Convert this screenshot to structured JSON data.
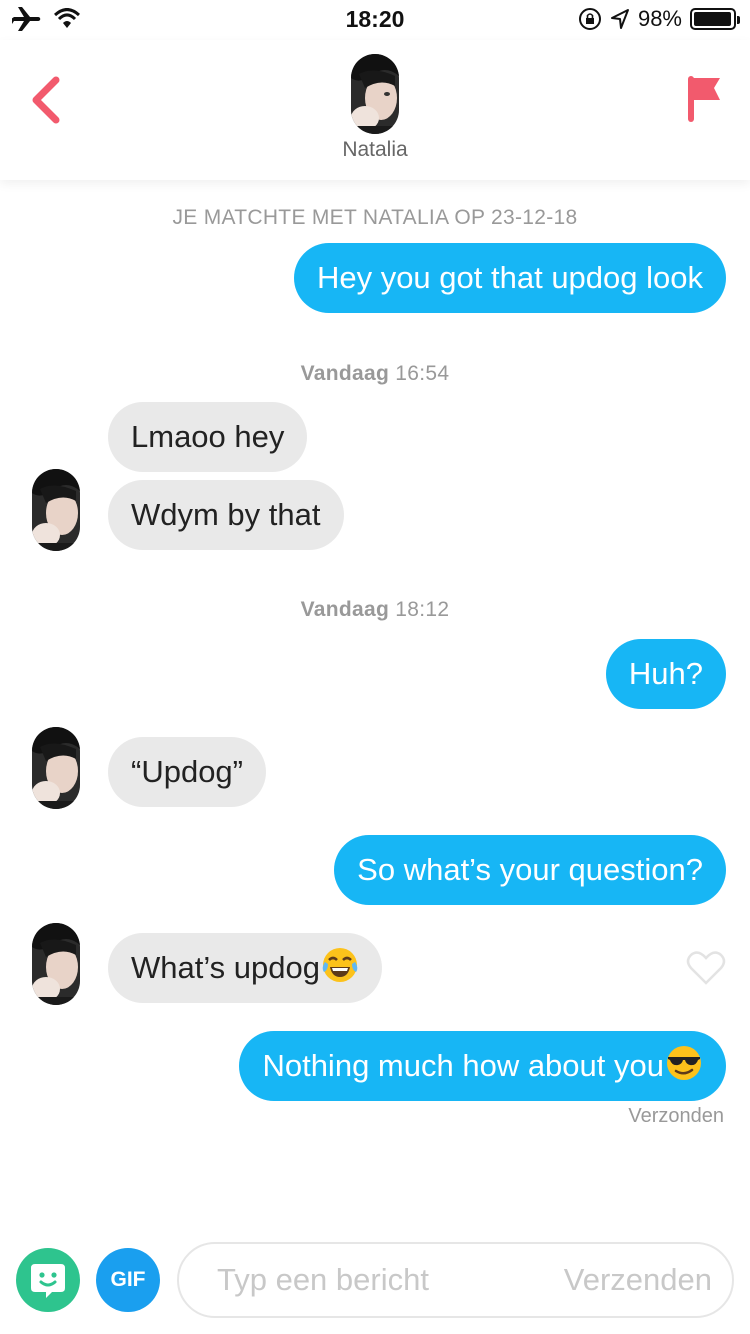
{
  "status_bar": {
    "time": "18:20",
    "battery_percent": "98%",
    "battery_level": 0.98
  },
  "header": {
    "match_name": "Natalia",
    "back_icon": "chevron-left-icon",
    "report_icon": "flag-icon",
    "accent_color": "#f25a6d"
  },
  "chat": {
    "match_notice": "JE MATCHTE MET NATALIA OP 23-12-18",
    "separators": [
      {
        "day": "Vandaag",
        "time": "16:54"
      },
      {
        "day": "Vandaag",
        "time": "18:12"
      }
    ],
    "messages": [
      {
        "from": "me",
        "text": "Hey you got that updog look"
      },
      {
        "from": "match",
        "text": "Lmaoo hey"
      },
      {
        "from": "match",
        "text": "Wdym by that"
      },
      {
        "from": "me",
        "text": "Huh?"
      },
      {
        "from": "match",
        "text": "“Updog”"
      },
      {
        "from": "me",
        "text": "So what’s your question?"
      },
      {
        "from": "match",
        "text": "What’s updog",
        "emoji": "face-with-tears-of-joy"
      },
      {
        "from": "me",
        "text": "Nothing much how about you",
        "emoji": "smiling-face-with-sunglasses"
      }
    ],
    "last_status": "Verzonden",
    "sent_color": "#17b6f5",
    "received_color": "#e9e9e9"
  },
  "composer": {
    "sticker_icon": "sticker-icon",
    "gif_label": "GIF",
    "placeholder": "Typ een bericht",
    "send_label": "Verzenden"
  }
}
